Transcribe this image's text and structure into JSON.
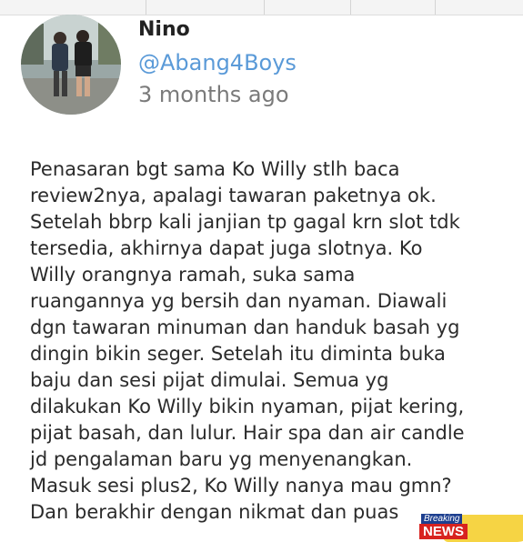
{
  "author": {
    "name": "Nino",
    "handle": "@Abang4Boys",
    "time": "3 months ago"
  },
  "review": {
    "lines": [
      "Penasaran bgt sama Ko Willy stlh baca",
      "review2nya, apalagi tawaran paketnya ok.",
      "Setelah bbrp kali janjian tp gagal krn slot tdk",
      "tersedia, akhirnya dapat juga slotnya. Ko",
      "Willy orangnya ramah, suka sama",
      "ruangannya yg bersih dan nyaman. Diawali",
      "dgn tawaran minuman dan handuk basah yg",
      "dingin bikin seger. Setelah itu diminta buka",
      "baju dan sesi pijat dimulai. Semua yg",
      "dilakukan Ko Willy bikin nyaman, pijat kering,",
      "pijat basah, dan lulur. Hair spa dan air candle",
      "jd pengalaman baru yg menyenangkan.",
      "Masuk sesi plus2, Ko Willy nanya mau gmn?",
      "Dan berakhir dengan nikmat dan puas"
    ]
  },
  "watermark": {
    "line1": "Breaking",
    "line2": "NEWS"
  },
  "colors": {
    "handle": "#5a9ad8",
    "time": "#7a7a7a",
    "body_text": "#2b2b2b",
    "name": "#222222"
  },
  "icons": {
    "avatar": "photo-of-two-men-walking"
  }
}
